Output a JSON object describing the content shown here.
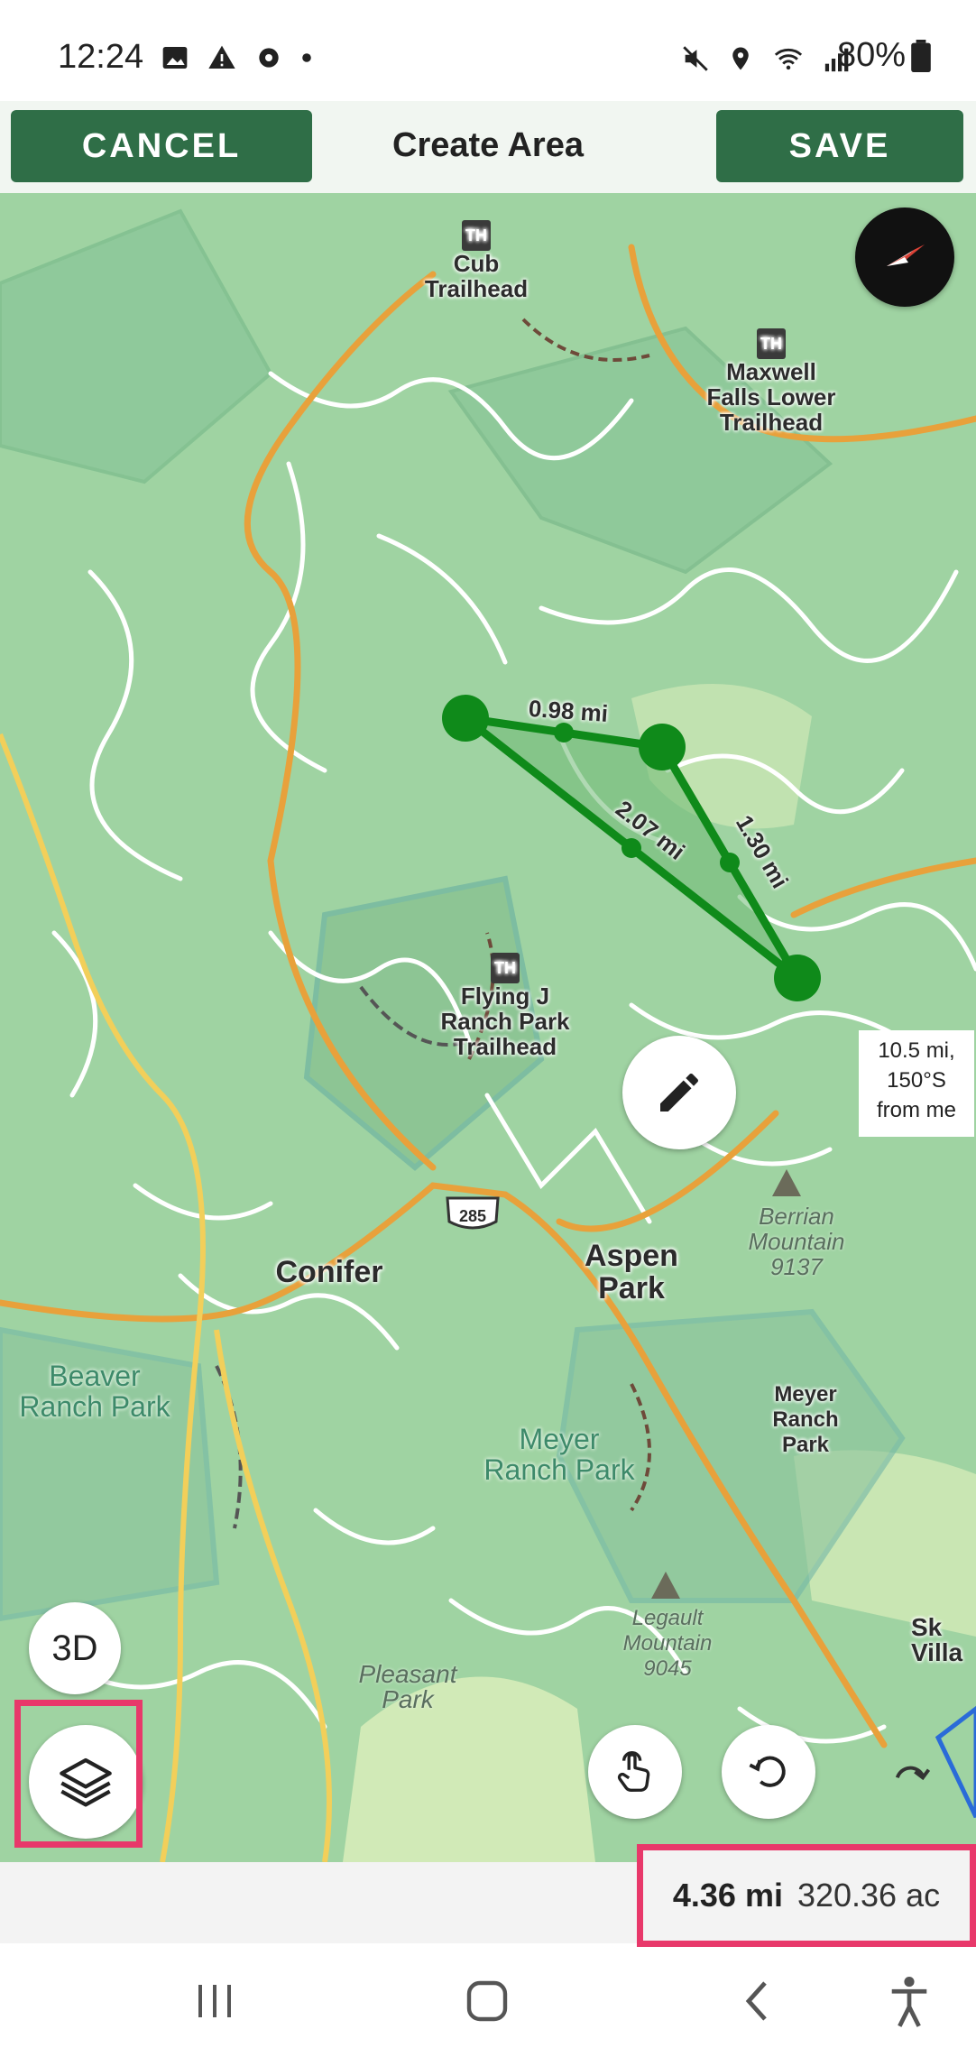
{
  "status_bar": {
    "time": "12:24",
    "battery": "80%",
    "left_icons": [
      "image-icon",
      "warning-icon",
      "settings-icon",
      "dot-icon"
    ],
    "right_icons": [
      "mute-icon",
      "location-icon",
      "wifi-icon",
      "signal-icon",
      "battery-icon"
    ]
  },
  "toolbar": {
    "cancel_label": "CANCEL",
    "title": "Create Area",
    "save_label": "SAVE"
  },
  "map": {
    "trailheads": [
      {
        "name": "Cub\nTrailhead"
      },
      {
        "name": "Maxwell\nFalls Lower\nTrailhead"
      },
      {
        "name": "Flying J\nRanch Park\nTrailhead"
      }
    ],
    "towns": {
      "conifer": "Conifer",
      "aspen_park": "Aspen\nPark"
    },
    "parks": {
      "beaver_ranch": "Beaver\nRanch Park",
      "meyer_ranch": "Meyer\nRanch Park",
      "meyer_ranch_poi": "Meyer\nRanch\nPark"
    },
    "peaks": [
      {
        "name": "Berrian\nMountain\n9137"
      },
      {
        "name": "Legault\nMountain\n9045"
      }
    ],
    "places": {
      "pleasant_park": "Pleasant\nPark",
      "sky_village": "Sk\nVilla"
    },
    "highway_shield": "285",
    "segments": [
      {
        "label": "0.98 mi"
      },
      {
        "label": "2.07 mi"
      },
      {
        "label": "1.30 mi"
      }
    ],
    "th_badge": "TH",
    "location_info": "10.5 mi,\n150°S\nfrom me"
  },
  "controls": {
    "three_d_label": "3D"
  },
  "measurement": {
    "distance": "4.36 mi",
    "area": "320.36 ac"
  },
  "colors": {
    "accent_green": "#2f6e47",
    "polygon_green": "#0f8a1a",
    "highlight": "#e8386a",
    "map_base": "#9fd3a2"
  }
}
